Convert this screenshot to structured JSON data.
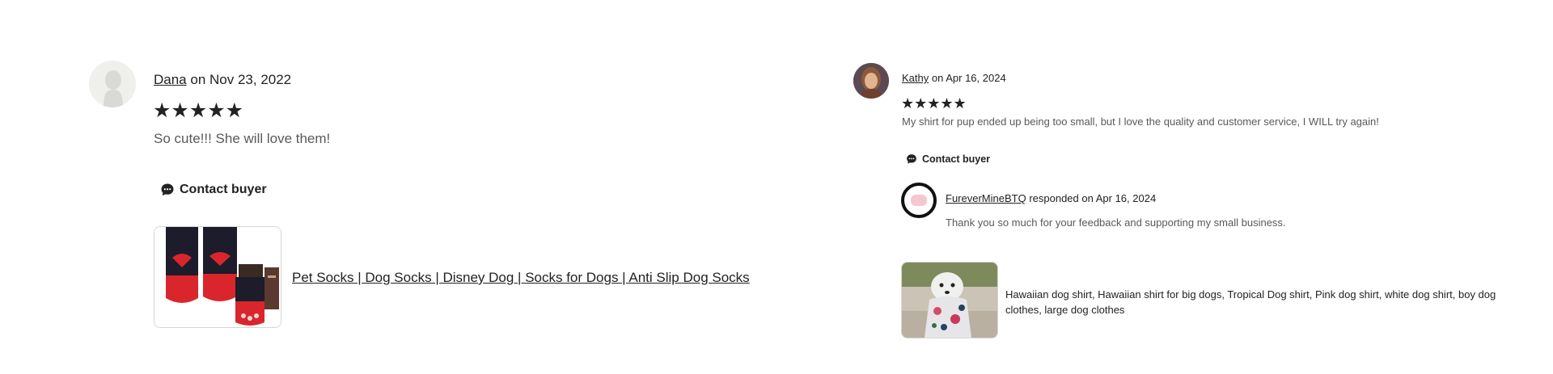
{
  "reviews": [
    {
      "reviewer": "Dana",
      "date_text": "on Nov 23, 2022",
      "rating": 5,
      "stars": "★★★★★",
      "text": "So cute!!! She will love them!",
      "contact_label": "Contact buyer",
      "item_title": "Pet Socks | Dog Socks | Disney Dog | Socks for Dogs | Anti Slip Dog Socks"
    },
    {
      "reviewer": "Kathy",
      "date_text": "on Apr 16, 2024",
      "rating": 5,
      "stars": "★★★★★",
      "text": "My shirt for pup ended up being too small, but I love the quality and customer service, I WILL try again!",
      "contact_label": "Contact buyer",
      "response": {
        "shop": "FureverMineBTQ",
        "date_text": "responded on Apr 16, 2024",
        "text": "Thank you so much for your feedback and supporting my small business."
      },
      "item_title": "Hawaiian dog shirt, Hawaiian shirt for big dogs, Tropical Dog shirt, Pink dog shirt, white dog shirt, boy dog clothes, large dog clothes"
    }
  ],
  "colors": {
    "text": "#222222",
    "muted": "#595959",
    "border": "#d6d6d6",
    "sock_red": "#d9262c",
    "sock_black": "#1c1c2a"
  }
}
